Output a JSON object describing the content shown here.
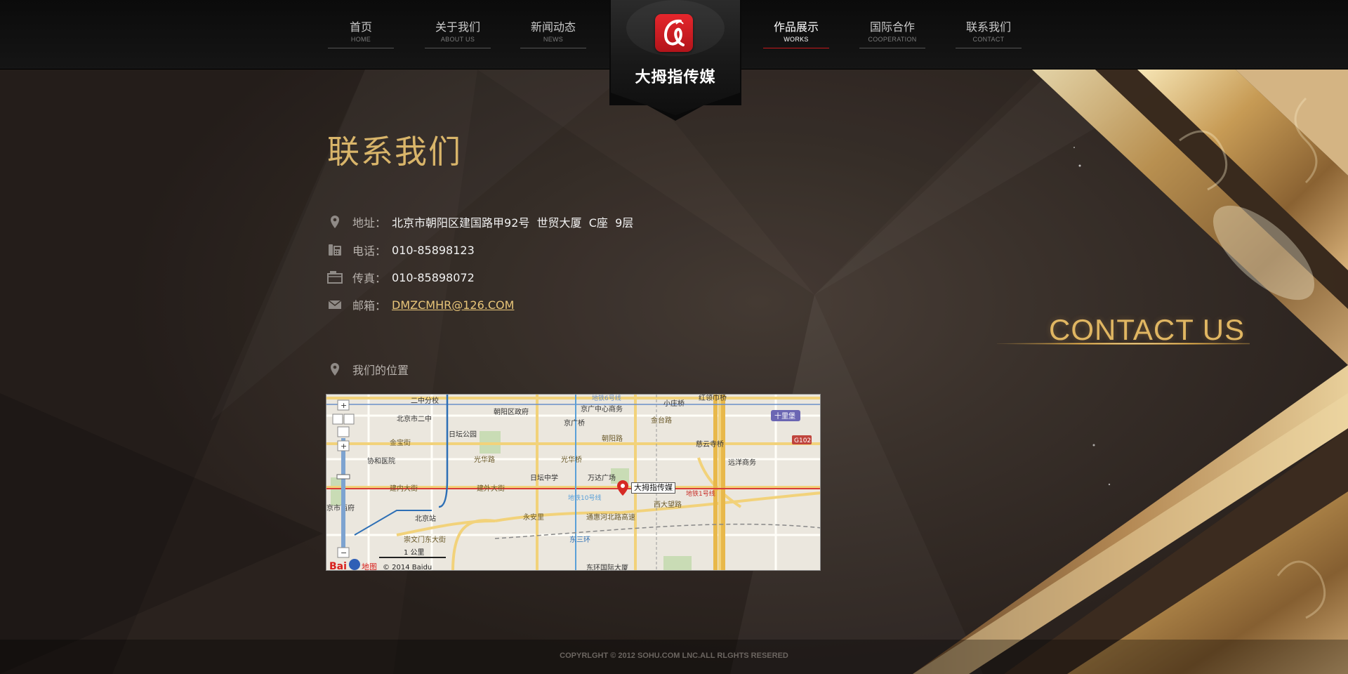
{
  "nav": {
    "items": [
      {
        "cn": "首页",
        "en": "HOME"
      },
      {
        "cn": "关于我们",
        "en": "ABOUT US"
      },
      {
        "cn": "新闻动态",
        "en": "NEWS"
      },
      {
        "cn": "作品展示",
        "en": "WORKS"
      },
      {
        "cn": "国际合作",
        "en": "COOPERATION"
      },
      {
        "cn": "联系我们",
        "en": "CONTACT"
      }
    ],
    "active": "作品展示"
  },
  "logo": {
    "text": "大拇指传媒",
    "icon": "brand-a-icon",
    "color": "#d71e24"
  },
  "page": {
    "title": "联系我们"
  },
  "contact": {
    "address_label": "地址：",
    "address": "北京市朝阳区建国路甲92号  世贸大厦  C座  9层",
    "phone_label": "电话：",
    "phone": "010-85898123",
    "fax_label": "传真：",
    "fax": "010-85898072",
    "email_label": "邮箱：",
    "email": "DMZCMHR@126.COM"
  },
  "location": {
    "title": "我们的位置"
  },
  "map": {
    "marker_label": "大拇指传媒",
    "scale_label": "1 公里",
    "copyright": "© 2014 Baidu",
    "brand": "Bai",
    "brand_suffix": "地图",
    "streets": {
      "jiannei": "建内大街",
      "jianwai": "建外大街",
      "guanghua": "光华路",
      "chaoyang": "朝阳路",
      "jingui": "金台路",
      "chongwen": "崇文门东大街",
      "tonghui": "通惠河北路高速",
      "xidawang": "西大望路",
      "jinbao": "金宝街",
      "yongan": "永安里",
      "dongsanhuan": "东三环",
      "huaguang": "光华桥"
    },
    "pois": {
      "erzhong": "二中分校",
      "beijingerzhong": "北京市二中",
      "chaoyangzf": "朝阳区政府",
      "guangzhong": "京广中心商务",
      "jingguangqiao": "京广桥",
      "ritan": "日坛公园",
      "xiehe": "协和医院",
      "ritanzx": "日坛中学",
      "wanda": "万达广场",
      "beijingzhan": "北京站",
      "dongfang": "东环国际大厦",
      "ciyunsi": "慈云寺桥",
      "yuanyang": "远洋商务",
      "shilipu": "十里堡",
      "xiaozhuang": "小庄桥",
      "hongmiao": "红领巾桥",
      "g102": "G102",
      "line6": "地铁6号线",
      "line1": "地铁1号线",
      "line10": "地铁10号线",
      "fuxing": "府",
      "jingdongfu": "京市西府"
    }
  },
  "hero": {
    "text": "CONTACT US"
  },
  "footer": {
    "text": "COPYRLGHT © 2012 SOHU.COM LNC.ALL RLGHTS RESERED"
  }
}
